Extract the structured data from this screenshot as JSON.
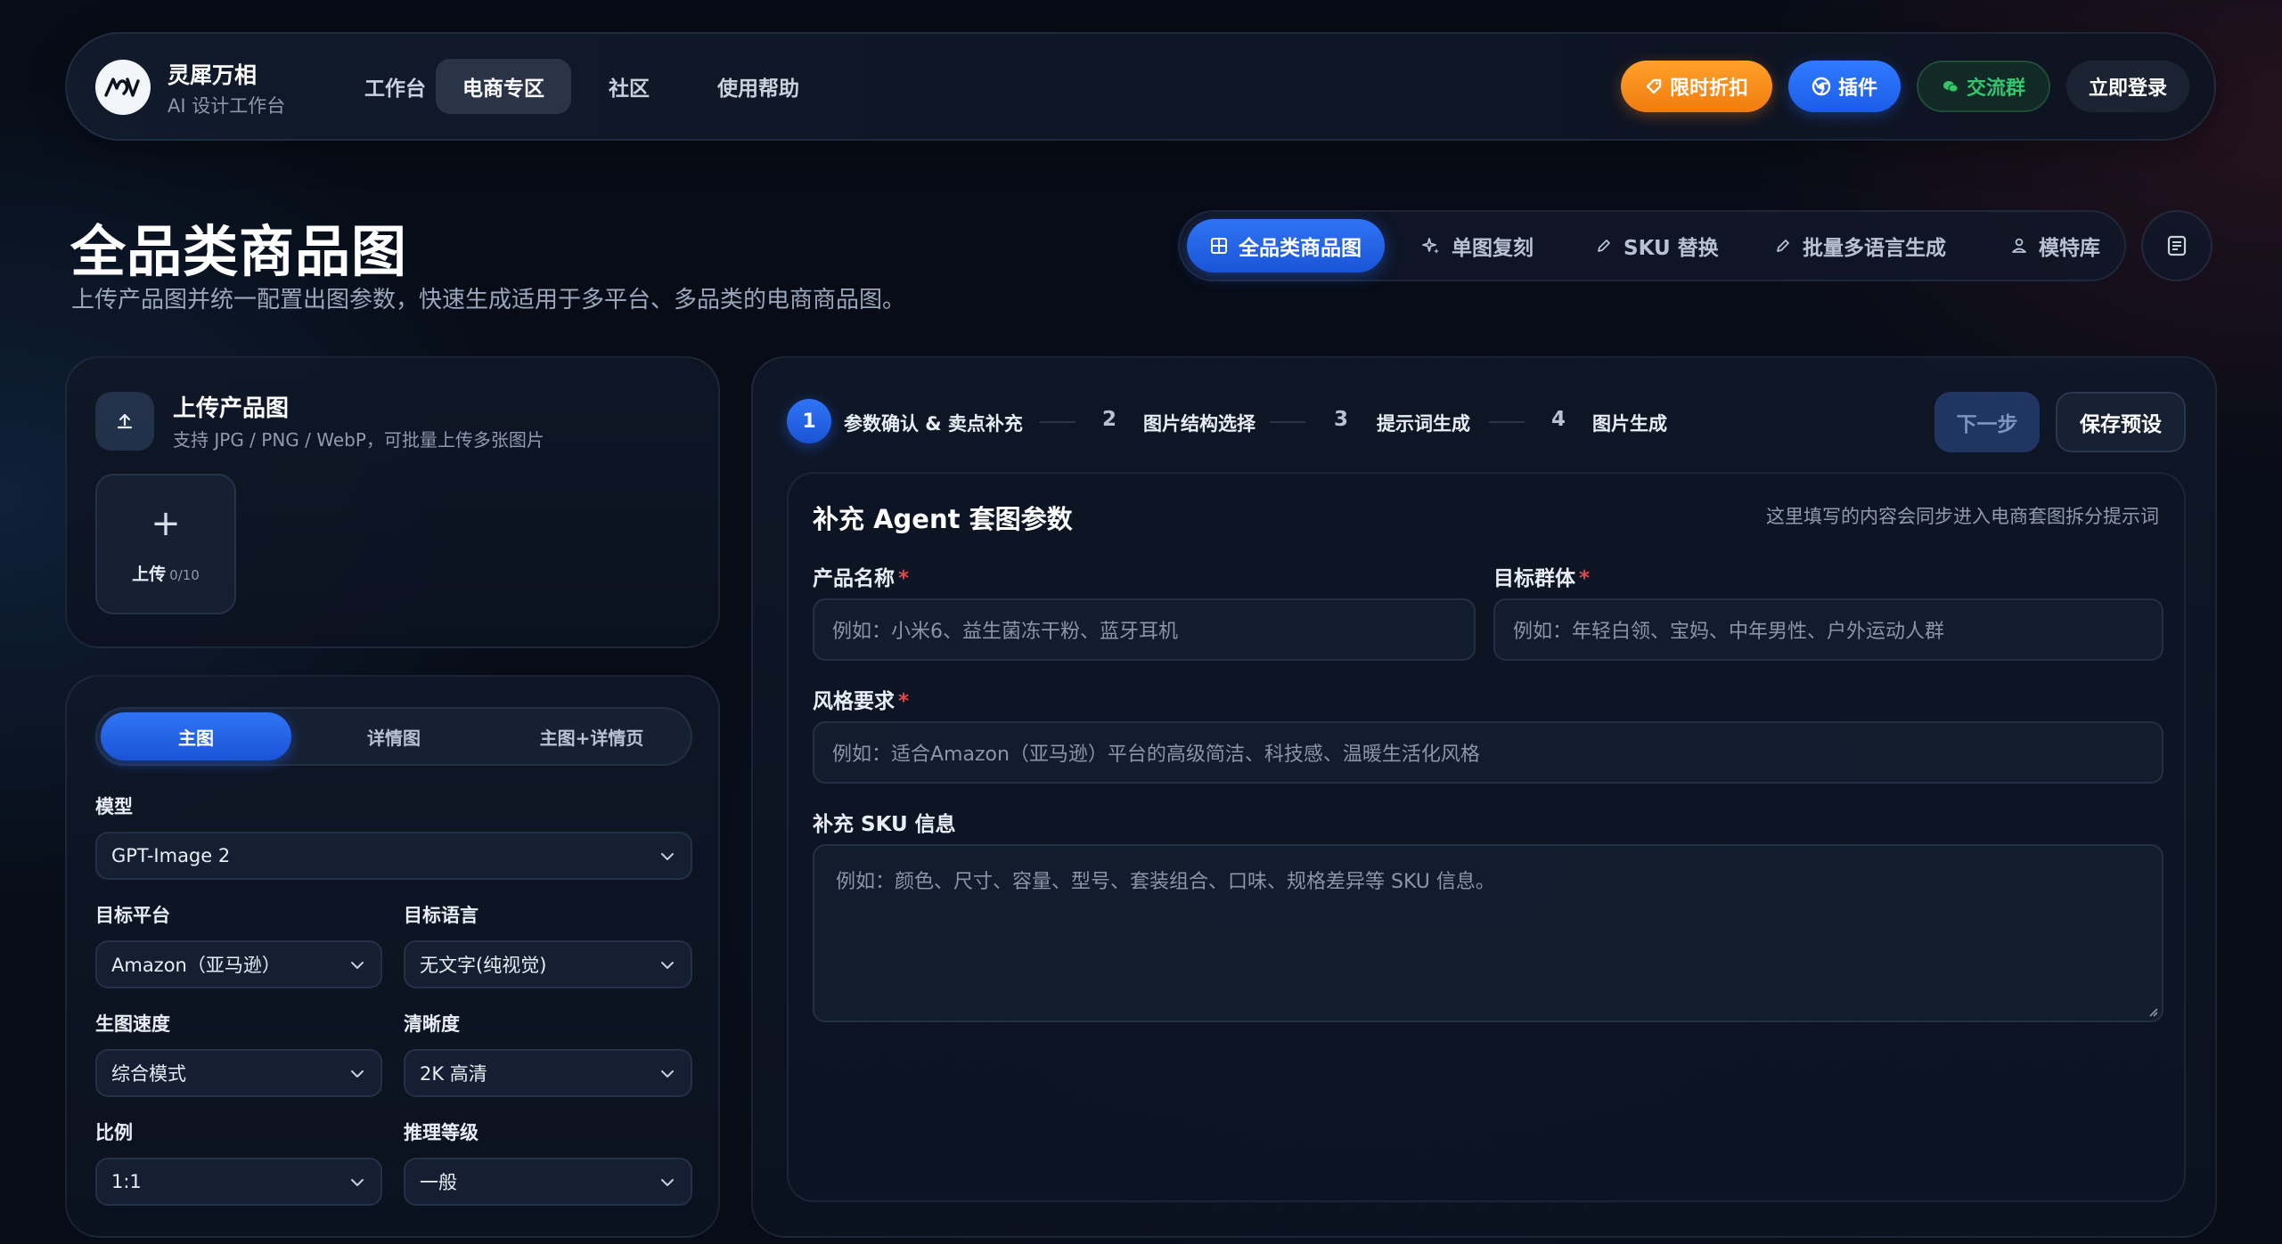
{
  "brand": {
    "name": "灵犀万相",
    "subtitle": "AI 设计工作台"
  },
  "nav": [
    {
      "label": "工作台"
    },
    {
      "label": "电商专区"
    },
    {
      "label": "社区"
    },
    {
      "label": "使用帮助"
    }
  ],
  "top_actions": {
    "discount": "限时折扣",
    "plugin": "插件",
    "group": "交流群",
    "login": "立即登录"
  },
  "page": {
    "title": "全品类商品图",
    "subtitle": "上传产品图并统一配置出图参数，快速生成适用于多平台、多品类的电商商品图。"
  },
  "mode_tabs": [
    {
      "label": "全品类商品图",
      "icon": "grid-icon"
    },
    {
      "label": "单图复刻",
      "icon": "sparkle-icon"
    },
    {
      "label": "SKU 替换",
      "icon": "pencil-icon"
    },
    {
      "label": "批量多语言生成",
      "icon": "pencil-icon"
    },
    {
      "label": "模特库",
      "icon": "person-icon"
    }
  ],
  "upload": {
    "title": "上传产品图",
    "hint": "支持 JPG / PNG / WebP，可批量上传多张图片",
    "button": "上传",
    "count": "0/10"
  },
  "settings": {
    "segments": [
      "主图",
      "详情图",
      "主图+详情页"
    ],
    "model_label": "模型",
    "model_value": "GPT-Image 2",
    "platform_label": "目标平台",
    "platform_value": "Amazon（亚马逊）",
    "language_label": "目标语言",
    "language_value": "无文字(纯视觉)",
    "speed_label": "生图速度",
    "speed_value": "综合模式",
    "clarity_label": "清晰度",
    "clarity_value": "2K 高清",
    "ratio_label": "比例",
    "ratio_value": "1:1",
    "reasoning_label": "推理等级",
    "reasoning_value": "一般"
  },
  "steps": [
    {
      "num": "1",
      "label": "参数确认 & 卖点补充"
    },
    {
      "num": "2",
      "label": "图片结构选择"
    },
    {
      "num": "3",
      "label": "提示词生成"
    },
    {
      "num": "4",
      "label": "图片生成"
    }
  ],
  "step_actions": {
    "next": "下一步",
    "save": "保存预设"
  },
  "agent": {
    "title": "补充 Agent 套图参数",
    "hint": "这里填写的内容会同步进入电商套图拆分提示词",
    "product_label": "产品名称",
    "product_placeholder": "例如：小米6、益生菌冻干粉、蓝牙耳机",
    "audience_label": "目标群体",
    "audience_placeholder": "例如：年轻白领、宝妈、中年男性、户外运动人群",
    "style_label": "风格要求",
    "style_placeholder": "例如：适合Amazon（亚马逊）平台的高级简洁、科技感、温暖生活化风格",
    "sku_label": "补充 SKU 信息",
    "sku_placeholder": "例如：颜色、尺寸、容量、型号、套装组合、口味、规格差异等 SKU 信息。",
    "required_mark": "*"
  },
  "colors": {
    "accent": "#2f74f5",
    "discount": "#f7901c",
    "group": "#36c46d",
    "required": "#e0484a"
  }
}
